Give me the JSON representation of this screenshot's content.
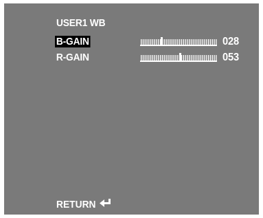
{
  "menu": {
    "title": "USER1 WB",
    "items": [
      {
        "label": "B-GAIN",
        "value": "028",
        "level": 0.28,
        "selected": true
      },
      {
        "label": "R-GAIN",
        "value": "053",
        "level": 0.53,
        "selected": false
      }
    ],
    "return_label": "RETURN"
  },
  "icons": {
    "return": "return-arrow-icon"
  },
  "colors": {
    "screen_bg": "#7a7a7a",
    "text": "#ffffff",
    "selection_bg": "#000000"
  }
}
